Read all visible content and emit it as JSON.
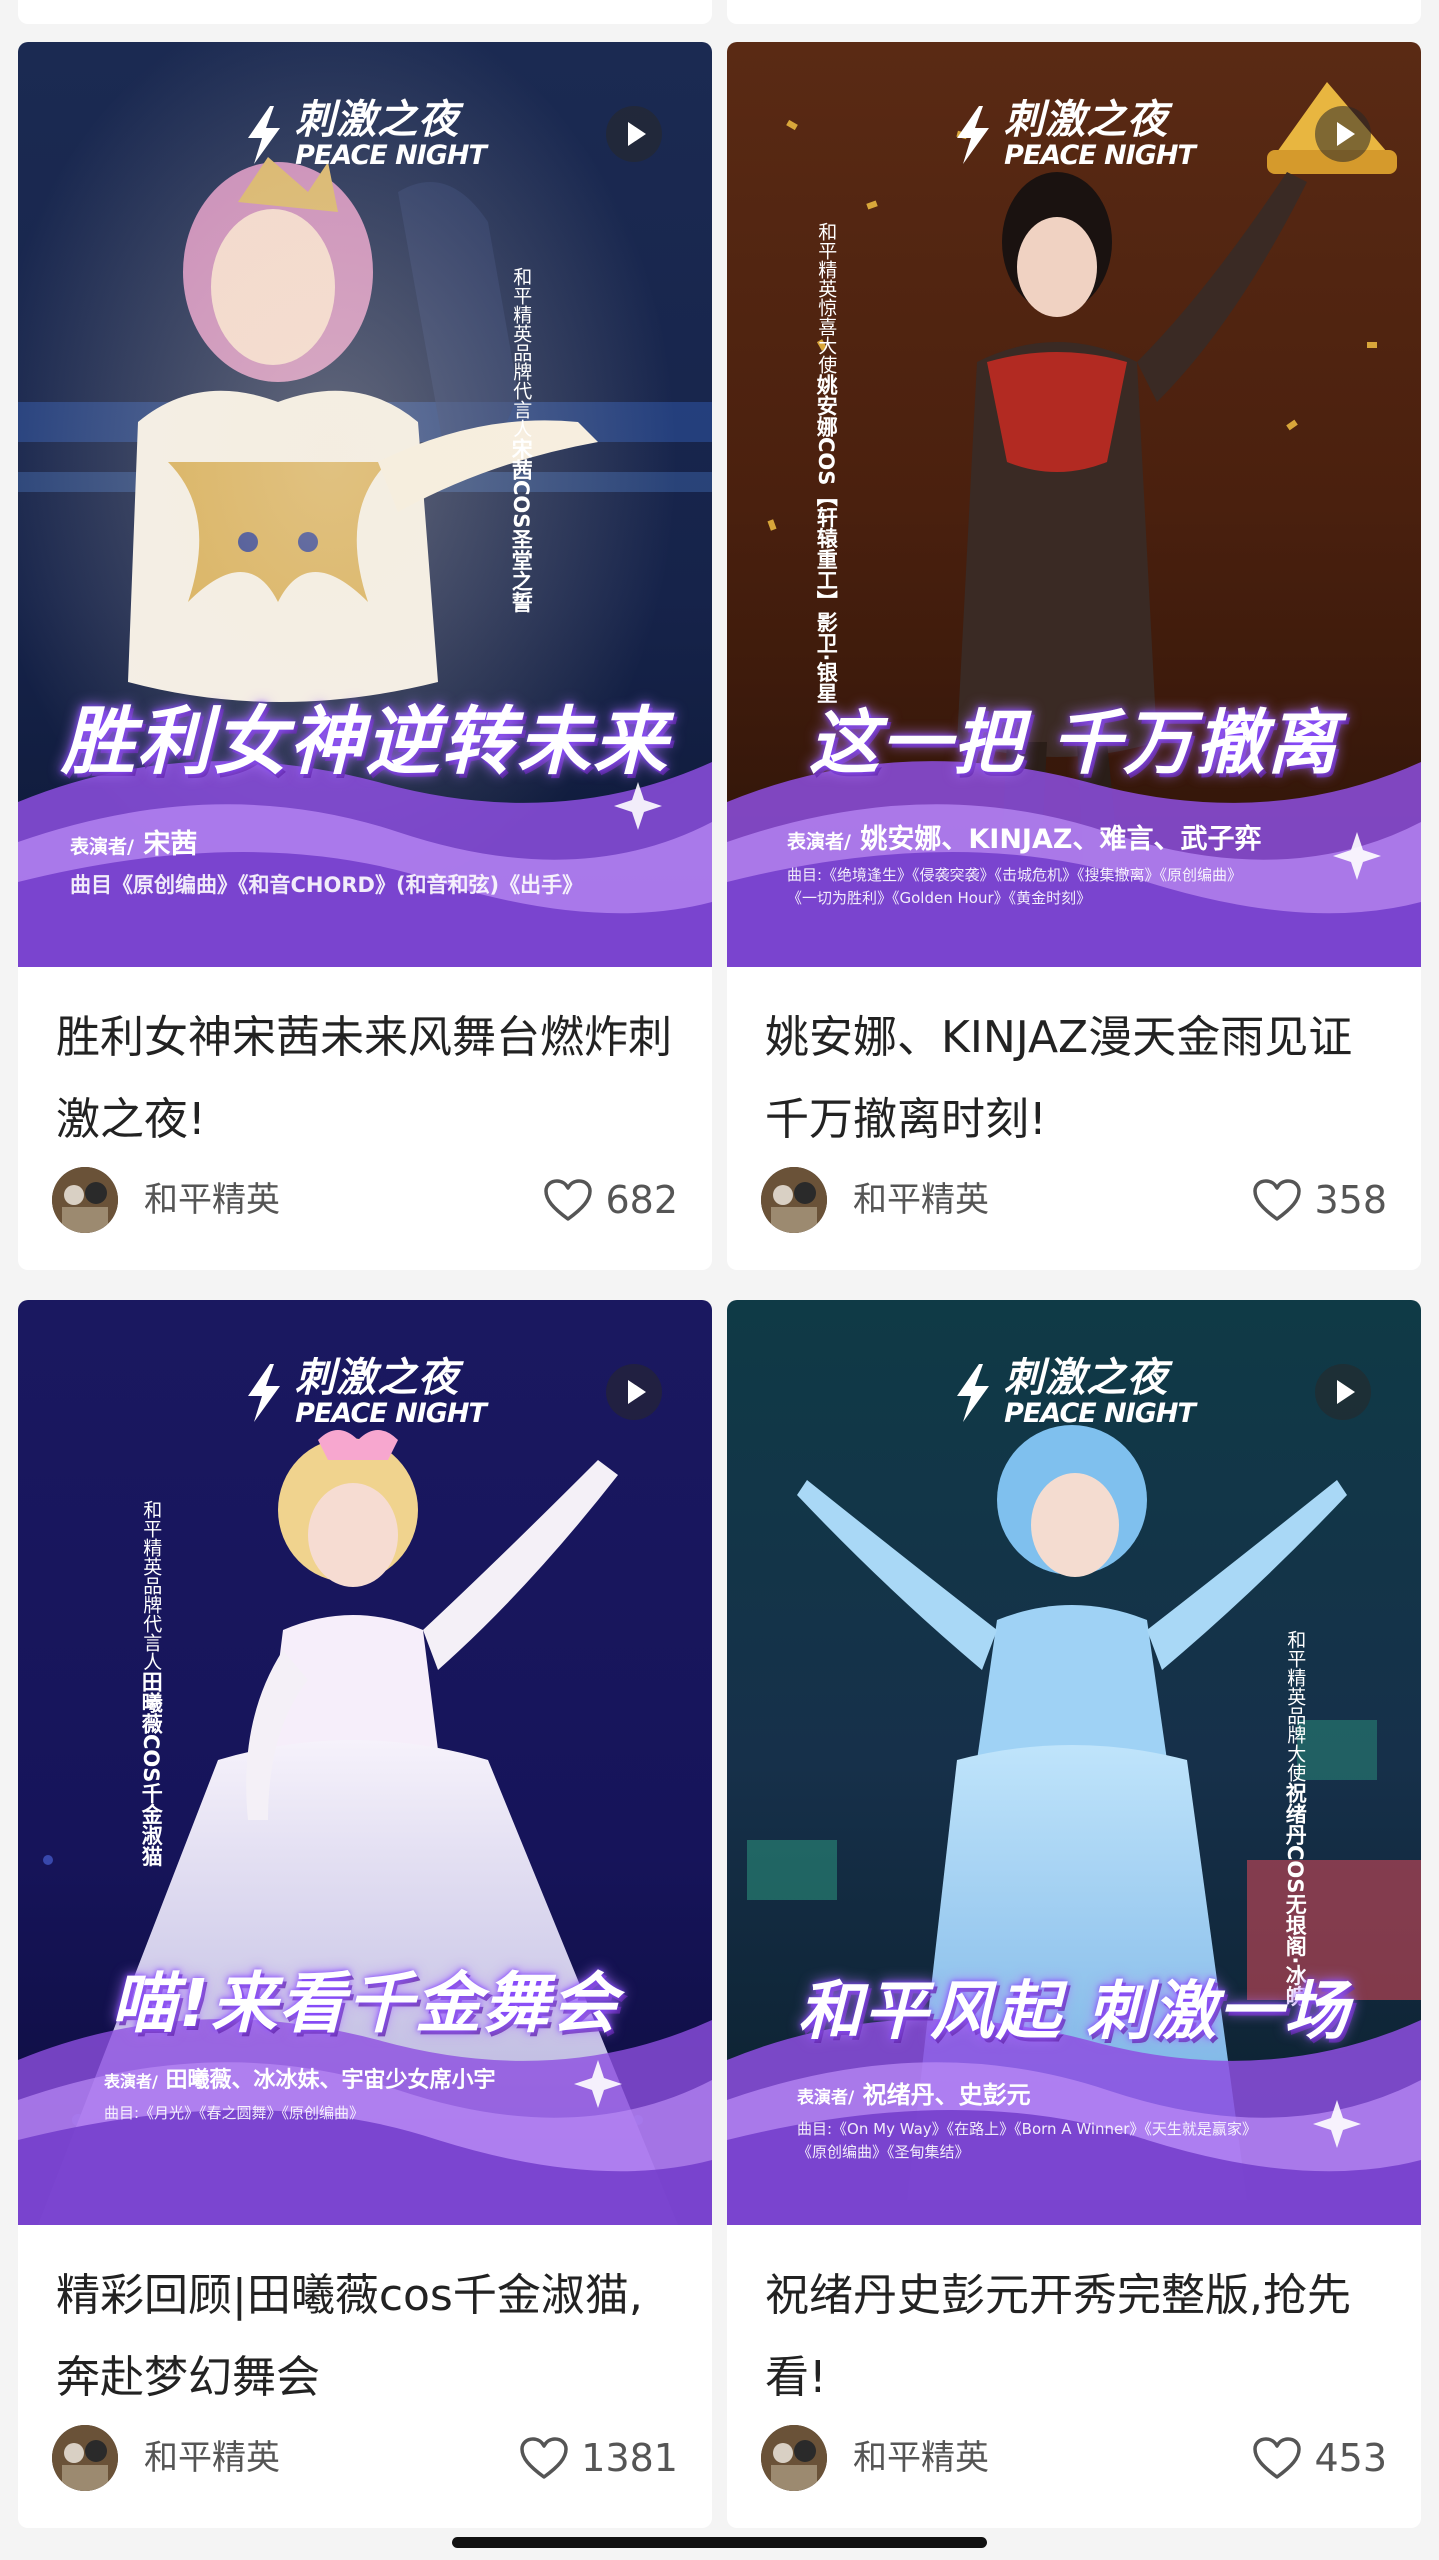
{
  "feed": {
    "cards": [
      {
        "logo_cn": "刺激之夜",
        "logo_en": "PEACE NIGHT",
        "vertical_role": "和平精英品牌代言人",
        "vertical_name": "宋茜COS圣堂之誓",
        "poster_headline": "胜利女神逆转未来",
        "performer_label": "表演者/",
        "performers": "宋茜",
        "songs_line1": "曲目《原创编曲》《和音CHORD》(和音和弦)《出手》",
        "songs_line2": "",
        "title": "胜利女神宋茜未来风舞台燃炸刺激之夜!",
        "author": "和平精英",
        "likes": "682",
        "colors": {
          "bg_top": "#1b2a52",
          "bg_bottom": "#0d1836",
          "accent": "#3d6fd6"
        }
      },
      {
        "logo_cn": "刺激之夜",
        "logo_en": "PEACE NIGHT",
        "vertical_role": "和平精英惊喜大使",
        "vertical_name": "姚安娜COS【轩辕重工】影卫·银星",
        "poster_headline": "这一把 千万撤离",
        "performer_label": "表演者/",
        "performers": "姚安娜、KINJAZ、难言、武子弈",
        "songs_line1": "曲目:《绝境逢生》《侵袭突袭》《击城危机》《搜集撤离》《原创编曲》",
        "songs_line2": "《一切为胜利》《Golden Hour》《黄金时刻》",
        "title": "姚安娜、KINJAZ漫天金雨见证千万撤离时刻!",
        "author": "和平精英",
        "likes": "358",
        "colors": {
          "bg_top": "#5a2a14",
          "bg_bottom": "#2a1208",
          "accent": "#e0a838"
        }
      },
      {
        "logo_cn": "刺激之夜",
        "logo_en": "PEACE NIGHT",
        "vertical_role": "和平精英品牌代言人",
        "vertical_name": "田曦薇COS千金淑猫",
        "poster_headline": "喵!来看千金舞会",
        "performer_label": "表演者/",
        "performers": "田曦薇、冰冰妹、宇宙少女席小宇",
        "songs_line1": "曲目:《月光》《春之圆舞》《原创编曲》",
        "songs_line2": "",
        "title": "精彩回顾|田曦薇cos千金淑猫,奔赴梦幻舞会",
        "author": "和平精英",
        "likes": "1381",
        "colors": {
          "bg_top": "#1a1860",
          "bg_bottom": "#0c0c3a",
          "accent": "#d8d0ff"
        }
      },
      {
        "logo_cn": "刺激之夜",
        "logo_en": "PEACE NIGHT",
        "vertical_role": "和平精英品牌大使",
        "vertical_name": "祝绪丹COS无垠阁·冰魄",
        "poster_headline": "和平风起 刺激一场",
        "performer_label": "表演者/",
        "performers": "祝绪丹、史彭元",
        "songs_line1": "曲目:《On My Way》《在路上》《Born A Winner》《天生就是赢家》",
        "songs_line2": "《原创编曲》《圣甸集结》",
        "title": "祝绪丹史彭元开秀完整版,抢先看!",
        "author": "和平精英",
        "likes": "453",
        "colors": {
          "bg_top": "#0f3a46",
          "bg_bottom": "#0a1e2a",
          "accent": "#7fc8f0"
        }
      }
    ]
  },
  "icons": {
    "play": "play-icon",
    "heart": "heart-outline-icon",
    "logo_mark": "lightning-bolt-icon"
  },
  "colors": {
    "page_bg": "#f4f4f4",
    "card_bg": "#ffffff",
    "title_text": "#222222",
    "meta_text": "#555555",
    "ribbon_purple": "#9b5cf0"
  }
}
